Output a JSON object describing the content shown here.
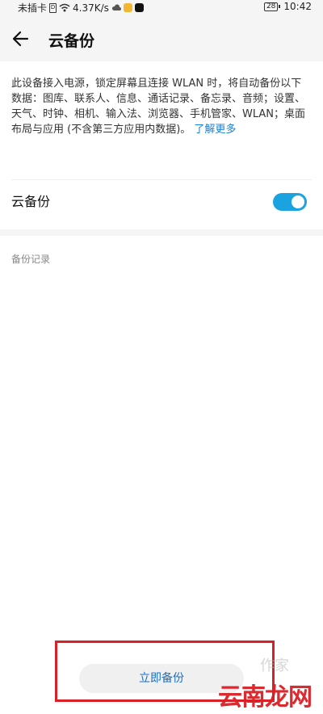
{
  "status_bar": {
    "carrier": "未插卡",
    "speed": "4.37K/s",
    "battery": "28",
    "time": "10:42"
  },
  "header": {
    "title": "云备份"
  },
  "description": {
    "text": "此设备接入电源，锁定屏幕且连接 WLAN 时，将自动备份以下数据：图库、联系人、信息、通话记录、备忘录、音频；设置、天气、时钟、相机、输入法、浏览器、手机管家、WLAN；桌面布局与应用 (不含第三方应用内数据)。",
    "link_label": "了解更多"
  },
  "cloud_backup": {
    "label": "云备份",
    "enabled": true
  },
  "records": {
    "label": "备份记录"
  },
  "actions": {
    "backup_now": "立即备份"
  },
  "watermark": {
    "text": "云南龙网",
    "faint_text": "作家"
  },
  "colors": {
    "accent": "#1aa3e0",
    "link": "#1a7fd4",
    "highlight": "#d92027"
  }
}
